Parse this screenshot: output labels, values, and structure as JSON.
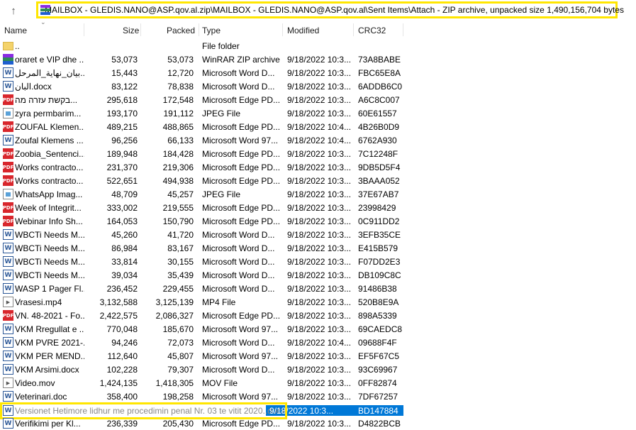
{
  "address_bar": {
    "path": "MAILBOX - GLEDIS.NANO@ASP.qov.al.zip\\MAILBOX - GLEDIS.NANO@ASP.qov.al\\Sent Items\\Attach - ZIP archive, unpacked size 1,490,156,704 bytes"
  },
  "columns": {
    "name": "Name",
    "size": "Size",
    "packed": "Packed",
    "type": "Type",
    "modified": "Modified",
    "crc": "CRC32"
  },
  "rows": [
    {
      "icon": "folder",
      "name": "..",
      "size": "",
      "packed": "",
      "type": "File folder",
      "modified": "",
      "crc": ""
    },
    {
      "icon": "zip",
      "name": "oraret e VIP dhe ...",
      "size": "53,073",
      "packed": "53,073",
      "type": "WinRAR ZIP archive",
      "modified": "9/18/2022 10:3...",
      "crc": "73A8BABE"
    },
    {
      "icon": "word",
      "name": "بيان_نهاية_المرحل...",
      "size": "15,443",
      "packed": "12,720",
      "type": "Microsoft Word D...",
      "modified": "9/18/2022 10:3...",
      "crc": "FBC65E8A"
    },
    {
      "icon": "word",
      "name": "البان.docx",
      "size": "83,122",
      "packed": "78,838",
      "type": "Microsoft Word D...",
      "modified": "9/18/2022 10:3...",
      "crc": "6ADDB6C0"
    },
    {
      "icon": "pdf",
      "name": "בקשת עזרה מה...",
      "size": "295,618",
      "packed": "172,548",
      "type": "Microsoft Edge PD...",
      "modified": "9/18/2022 10:3...",
      "crc": "A6C8C007"
    },
    {
      "icon": "jpg",
      "name": "zyra permbarim...",
      "size": "193,170",
      "packed": "191,112",
      "type": "JPEG File",
      "modified": "9/18/2022 10:3...",
      "crc": "60E61557"
    },
    {
      "icon": "pdf",
      "name": "ZOUFAL Klemen...",
      "size": "489,215",
      "packed": "488,865",
      "type": "Microsoft Edge PD...",
      "modified": "9/18/2022 10:4...",
      "crc": "4B26B0D9"
    },
    {
      "icon": "word",
      "name": "Zoufal Klemens ...",
      "size": "96,256",
      "packed": "66,133",
      "type": "Microsoft Word 97...",
      "modified": "9/18/2022 10:4...",
      "crc": "6762A930"
    },
    {
      "icon": "pdf",
      "name": "Zoobia_Sentenci...",
      "size": "189,948",
      "packed": "184,428",
      "type": "Microsoft Edge PD...",
      "modified": "9/18/2022 10:3...",
      "crc": "7C12248F"
    },
    {
      "icon": "pdf",
      "name": "Works contracto...",
      "size": "231,370",
      "packed": "219,306",
      "type": "Microsoft Edge PD...",
      "modified": "9/18/2022 10:3...",
      "crc": "9DB5D5F4"
    },
    {
      "icon": "pdf",
      "name": "Works contracto...",
      "size": "522,651",
      "packed": "494,938",
      "type": "Microsoft Edge PD...",
      "modified": "9/18/2022 10:3...",
      "crc": "3BAAA052"
    },
    {
      "icon": "jpg",
      "name": "WhatsApp Imag...",
      "size": "48,709",
      "packed": "45,257",
      "type": "JPEG File",
      "modified": "9/18/2022 10:3...",
      "crc": "37E67AB7"
    },
    {
      "icon": "pdf",
      "name": "Week of Integrit...",
      "size": "333,002",
      "packed": "219,555",
      "type": "Microsoft Edge PD...",
      "modified": "9/18/2022 10:3...",
      "crc": "23998429"
    },
    {
      "icon": "pdf",
      "name": "Webinar Info Sh...",
      "size": "164,053",
      "packed": "150,790",
      "type": "Microsoft Edge PD...",
      "modified": "9/18/2022 10:3...",
      "crc": "0C911DD2"
    },
    {
      "icon": "word",
      "name": "WBCTi Needs M...",
      "size": "45,260",
      "packed": "41,720",
      "type": "Microsoft Word D...",
      "modified": "9/18/2022 10:3...",
      "crc": "3EFB35CE"
    },
    {
      "icon": "word",
      "name": "WBCTi Needs M...",
      "size": "86,984",
      "packed": "83,167",
      "type": "Microsoft Word D...",
      "modified": "9/18/2022 10:3...",
      "crc": "E415B579"
    },
    {
      "icon": "word",
      "name": "WBCTi Needs M...",
      "size": "33,814",
      "packed": "30,155",
      "type": "Microsoft Word D...",
      "modified": "9/18/2022 10:3...",
      "crc": "F07DD2E3"
    },
    {
      "icon": "word",
      "name": "WBCTi Needs M...",
      "size": "39,034",
      "packed": "35,439",
      "type": "Microsoft Word D...",
      "modified": "9/18/2022 10:3...",
      "crc": "DB109C8C"
    },
    {
      "icon": "word",
      "name": "WASP 1 Pager Fl...",
      "size": "236,452",
      "packed": "229,455",
      "type": "Microsoft Word D...",
      "modified": "9/18/2022 10:3...",
      "crc": "91486B38"
    },
    {
      "icon": "mp4",
      "name": "Vrasesi.mp4",
      "size": "3,132,588",
      "packed": "3,125,139",
      "type": "MP4 File",
      "modified": "9/18/2022 10:3...",
      "crc": "520B8E9A"
    },
    {
      "icon": "pdf",
      "name": "VN. 48-2021 - Fo...",
      "size": "2,422,575",
      "packed": "2,086,327",
      "type": "Microsoft Edge PD...",
      "modified": "9/18/2022 10:3...",
      "crc": "898A5339"
    },
    {
      "icon": "word",
      "name": "VKM Rregullat e ...",
      "size": "770,048",
      "packed": "185,670",
      "type": "Microsoft Word 97...",
      "modified": "9/18/2022 10:3...",
      "crc": "69CAEDC8"
    },
    {
      "icon": "word",
      "name": "VKM PVRE 2021-...",
      "size": "94,246",
      "packed": "72,073",
      "type": "Microsoft Word D...",
      "modified": "9/18/2022 10:4...",
      "crc": "09688F4F"
    },
    {
      "icon": "word",
      "name": "VKM PER MEND...",
      "size": "112,640",
      "packed": "45,807",
      "type": "Microsoft Word 97...",
      "modified": "9/18/2022 10:3...",
      "crc": "EF5F67C5"
    },
    {
      "icon": "word",
      "name": "VKM Arsimi.docx",
      "size": "102,228",
      "packed": "79,307",
      "type": "Microsoft Word D...",
      "modified": "9/18/2022 10:3...",
      "crc": "93C69967"
    },
    {
      "icon": "mp4",
      "name": "Video.mov",
      "size": "1,424,135",
      "packed": "1,418,305",
      "type": "MOV File",
      "modified": "9/18/2022 10:3...",
      "crc": "0FF82874"
    },
    {
      "icon": "word",
      "name": "Veterinari.doc",
      "size": "358,400",
      "packed": "198,258",
      "type": "Microsoft Word 97...",
      "modified": "9/18/2022 10:3...",
      "crc": "7DF67257"
    }
  ],
  "selected_row": {
    "name": "Versionet Hetimore lidhur me procedimin penal Nr. 03 te vitit 2020..docx",
    "modified": "9/18/2022 10:3...",
    "crc": "BD147884"
  },
  "last_row": {
    "name": "Verifikimi per Kl...",
    "size": "236,339",
    "packed": "205,430",
    "type": "Microsoft Edge PD...",
    "modified": "9/18/2022 10:3...",
    "crc": "D4822BCB"
  }
}
